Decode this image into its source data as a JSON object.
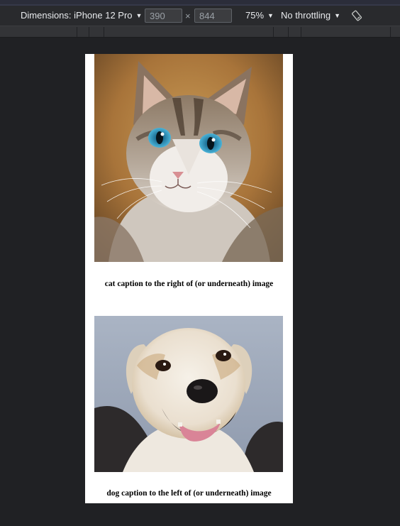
{
  "device_toolbar": {
    "dimensions_label": "Dimensions: iPhone 12 Pro",
    "width_value": "390",
    "height_value": "844",
    "times_symbol": "×",
    "zoom_label": "75%",
    "throttling_label": "No throttling",
    "rotate_icon": "rotate-icon",
    "caret_icon": "▼"
  },
  "page": {
    "items": [
      {
        "image_subject": "cat",
        "caption": "cat caption to the right of (or underneath) image"
      },
      {
        "image_subject": "dog",
        "caption": "dog caption to the left of (or underneath) image"
      }
    ]
  }
}
